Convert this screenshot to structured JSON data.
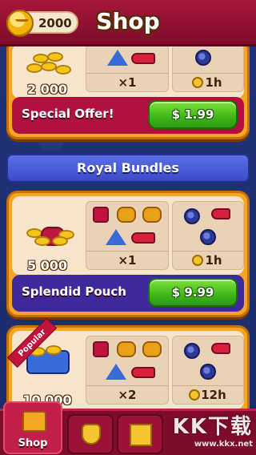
{
  "header": {
    "title": "Shop",
    "coins": "2000"
  },
  "offers": [
    {
      "amount": "2 000",
      "boosters_count": "×1",
      "timer": "1h",
      "label": "Special Offer!",
      "price": "$ 1.99"
    },
    {
      "amount": "5 000",
      "boosters_count": "×1",
      "timer": "1h",
      "label": "Splendid Pouch",
      "price": "$ 9.99"
    },
    {
      "badge": "Popular",
      "amount": "10 000",
      "boosters_count": "×2",
      "timer": "12h"
    }
  ],
  "section_title": "Royal Bundles",
  "nav": {
    "shop_label": "Shop"
  },
  "watermark": {
    "brand": "KK下载",
    "url": "www.kkx.net"
  },
  "colors": {
    "header": "#a8163c",
    "card": "#f5a623",
    "buy_button": "#3fb71a",
    "banner": "#3b4bc8"
  }
}
